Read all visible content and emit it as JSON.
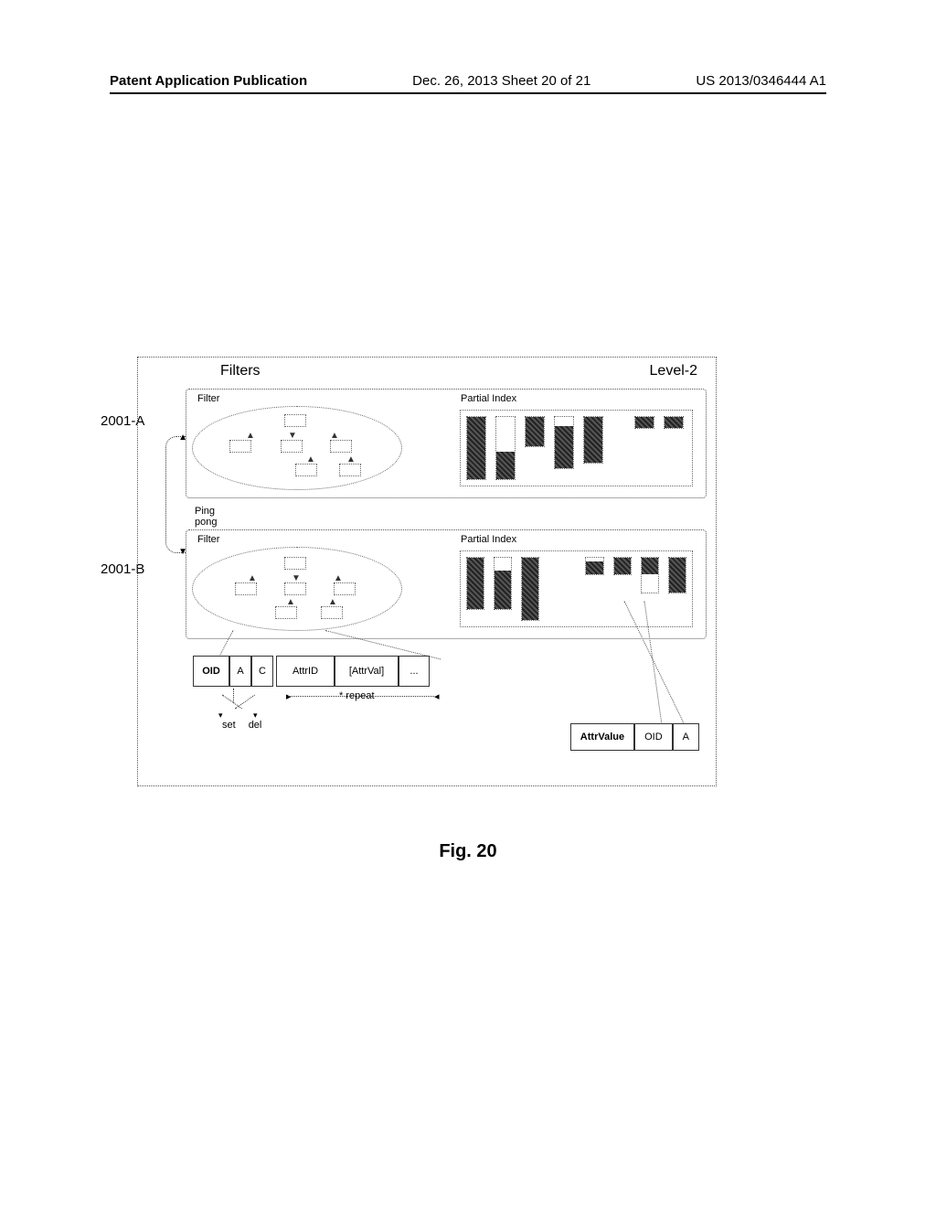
{
  "header": {
    "left": "Patent Application Publication",
    "center": "Dec. 26, 2013   Sheet 20 of 21",
    "right": "US 2013/0346444 A1"
  },
  "top": {
    "filters_heading": "Filters",
    "level2_heading": "Level-2"
  },
  "panel": {
    "filter_label": "Filter",
    "index_label": "Partial Index"
  },
  "refs": {
    "a": "2001-A",
    "b": "2001-B"
  },
  "pingpong": {
    "line1": "Ping",
    "line2": "pong"
  },
  "record": {
    "oid": "OID",
    "a": "A",
    "c": "C",
    "attrid": "AttrID",
    "attrval": "[AttrVal]",
    "etc": "..."
  },
  "repeat_label": "* repeat",
  "setdel": {
    "set": "set",
    "del": "del"
  },
  "attr_row": {
    "attrvalue": "AttrValue",
    "oid": "OID",
    "a": "A"
  },
  "caption": "Fig. 20"
}
